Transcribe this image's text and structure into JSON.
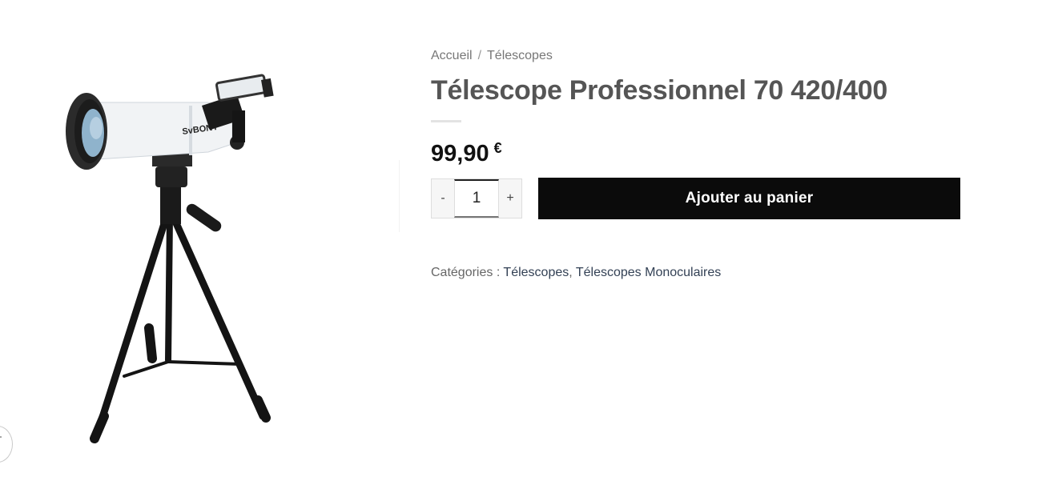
{
  "breadcrumb": {
    "home": "Accueil",
    "separator": "/",
    "current": "Télescopes"
  },
  "product": {
    "title": "Télescope Professionnel 70 420/400",
    "price_amount": "99,90",
    "price_currency": "€",
    "brand_text": "SvBONY",
    "image_icon": "telescope-on-tripod"
  },
  "cart": {
    "minus_label": "-",
    "quantity": "1",
    "plus_label": "+",
    "add_label": "Ajouter au panier"
  },
  "meta": {
    "categories_label": "Catégories :",
    "categories": [
      "Télescopes",
      "Télescopes Monoculaires"
    ],
    "category_separator": ","
  },
  "icons": {
    "zoom": "expand-icon"
  },
  "colors": {
    "button_bg": "#0b0b0b",
    "button_text": "#ffffff",
    "title": "#555555",
    "link": "#334155"
  }
}
